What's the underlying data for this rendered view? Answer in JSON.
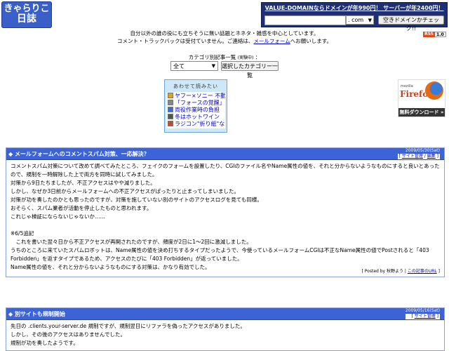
{
  "header": {
    "logo_line1": "きゃらりこ",
    "logo_line2": "日誌",
    "ad": {
      "link": "VALUE-DOMAINならドメインが年990円！ サーバーが年2400円！",
      "input_value": "",
      "tld": ". com",
      "button": "空きドメインかチェック!!"
    },
    "rss": {
      "label": "RSS",
      "version": "1.0"
    }
  },
  "intro": {
    "line1": "自分以外の誰の役にも立ちそうに無い話題とネネタ・雑感を中心としています。",
    "line2_prefix": "コメント・トラックバックは受付ていません。ご連絡は、",
    "line2_link": "メールフォーム",
    "line2_suffix": "へお願いします。"
  },
  "category": {
    "label": "カテゴリ別記事一覧",
    "label_small": "(実験中)",
    "label_suffix": "：",
    "selected": "全て",
    "button": "選択したカテゴリー一覧"
  },
  "news": {
    "title": "あわせて読みたい",
    "items": [
      {
        "label": "ヤフー×ソニー 不動",
        "icon_color": "#e8a020"
      },
      {
        "label": "「フォースの覚醒」",
        "icon_color": "#888888"
      },
      {
        "label": "両役作業時の負担",
        "icon_color": "#3a6fd6"
      },
      {
        "label": "冬はホットワイン",
        "icon_color": "#555555"
      },
      {
        "label": "ラジコン\"折り紙\"など",
        "icon_color": "#c84a2a"
      }
    ]
  },
  "firefox": {
    "mozilla": "mozilla",
    "name": "Firefox",
    "download": "無料ダウンロード »"
  },
  "entries": [
    {
      "title": "メールフォームへのコメントスパム対策、一応解決？",
      "date": "2009/05/30(Sat)",
      "category": "サイト管理",
      "edit": "編集",
      "body": [
        "コメントスパム対策について改めて調べてみたところ、フェイクのフォームを設置したり、CGIのファイル名やName属性の値を、それと分からないようなものにすると良いとあったので、規制を一時解除した上で両方を同時に試してみました。",
        "対策から9日たちましたが、不正アクセスはやや減りました。",
        "しかし、なぜか3日前からメールフォームへの不正アクセスがぱったりと止まってしまいました。",
        "対策が功を奏したのかとも思ったのですが、対策を施していない別のサイトのアクセスログを見ても同様。",
        "おそらく、スパム業者が活動を停止したものと思われます。",
        "これじゃ検証にならないじゃないか……",
        "",
        "※6/5追記",
        "　これを書いた翌々日から不正アクセスが再開されたのですが、頻度が2日に1～2回に激減しました。",
        "うちのところに来ていたスパムロボットは、Name属性の値を決め打ちするタイプだったようで、今使っているメールフォームCGIは不正なName属性の値でPostされると「403 Forbidden」を返すタイプであるため、アクセスのたびに「403 Forbidden」が返っていました。",
        "Name属性の値を、それと分からないようなものにする対策は、かなり有効でした。"
      ],
      "posted_by": "Posted by 秋野よう",
      "permalink": "この記事のURL"
    },
    {
      "title": "別サイトも規制開始",
      "date": "2009/05/16(Sat)",
      "category": "サイト管理",
      "body": [
        "先日の .clients.your-server.de 規制ですが、規制翌日にリファラを偽ったアクセスがありました。",
        "しかし、その後のアクセスはありませんでした。",
        "規制が功を奏したようです。"
      ]
    }
  ]
}
